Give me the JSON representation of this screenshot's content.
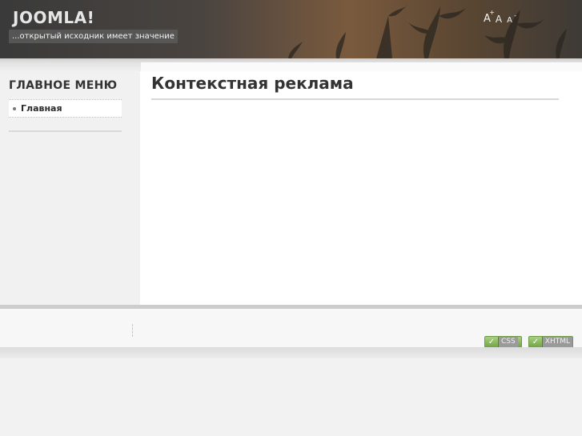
{
  "header": {
    "site_title": "JOOMLA!",
    "slogan": "...открытый исходник имеет значение",
    "font_controls": {
      "increase": "A",
      "increase_sup": "+",
      "reset": "A",
      "decrease": "A",
      "decrease_sup": "-"
    }
  },
  "sidebar": {
    "menu_title": "ГЛАВНОЕ МЕНЮ",
    "items": [
      {
        "label": "Главная"
      }
    ]
  },
  "main": {
    "page_title": "Контекстная реклама"
  },
  "footer": {
    "badges": [
      {
        "label": "CSS",
        "icon": "check-icon"
      },
      {
        "label": "XHTML",
        "icon": "check-icon"
      }
    ]
  },
  "colors": {
    "badge_green": "#7fb152",
    "sidebar_bg": "#f1f1f1",
    "header_dark": "#3a3a3a"
  }
}
